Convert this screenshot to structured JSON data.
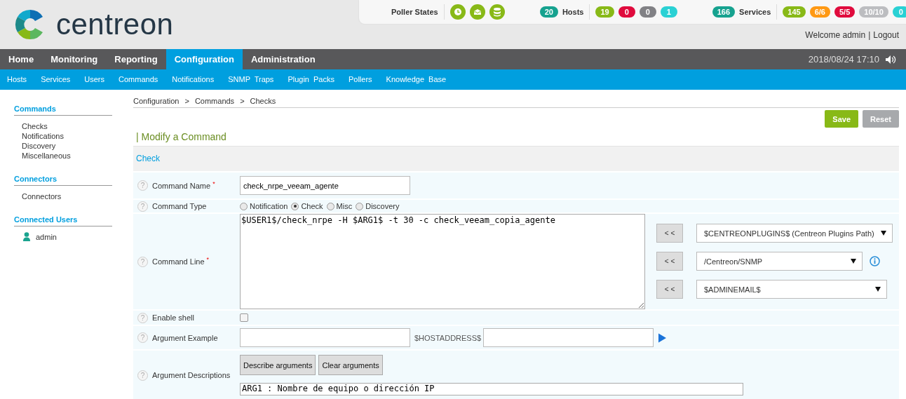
{
  "header": {
    "logo": "centreon",
    "poller_states": {
      "label": "Poller States"
    },
    "hosts": {
      "total": "20",
      "label": "Hosts",
      "badges": [
        {
          "text": "19",
          "color": "#88b917"
        },
        {
          "text": "0",
          "color": "#e00b3d"
        },
        {
          "text": "0",
          "color": "#818185"
        },
        {
          "text": "1",
          "color": "#2ad1d4"
        }
      ]
    },
    "services": {
      "total": "166",
      "label": "Services",
      "badges": [
        {
          "text": "145",
          "color": "#88b917"
        },
        {
          "text": "6/6",
          "color": "#ff9913"
        },
        {
          "text": "5/5",
          "color": "#e00b3d"
        },
        {
          "text": "10/10",
          "color": "#bcbdc0"
        },
        {
          "text": "0",
          "color": "#2ad1d4"
        }
      ]
    },
    "welcome": "Welcome admin",
    "separator": "|",
    "logout": "Logout"
  },
  "main_nav": {
    "tabs": [
      {
        "label": "Home",
        "selected": false
      },
      {
        "label": "Monitoring",
        "selected": false
      },
      {
        "label": "Reporting",
        "selected": false
      },
      {
        "label": "Configuration",
        "selected": true
      },
      {
        "label": "Administration",
        "selected": false
      }
    ],
    "datetime": "2018/08/24 17:10"
  },
  "sub_nav": {
    "items": [
      "Hosts",
      "Services",
      "Users",
      "Commands",
      "Notifications",
      "SNMP Traps",
      "Plugin Packs",
      "Pollers",
      "Knowledge Base"
    ]
  },
  "sidebar": {
    "sections": [
      {
        "title": "Commands",
        "items": [
          "Checks",
          "Notifications",
          "Discovery",
          "Miscellaneous"
        ]
      },
      {
        "title": "Connectors",
        "items": [
          "Connectors"
        ]
      },
      {
        "title": "Connected Users",
        "users": [
          "admin"
        ]
      }
    ]
  },
  "breadcrumb": {
    "items": [
      "Configuration",
      "Commands",
      "Checks"
    ],
    "separator": ">"
  },
  "buttons": [
    {
      "label": "Save",
      "kind": "primary"
    },
    {
      "label": "Reset",
      "kind": "secondary"
    }
  ],
  "form": {
    "title": "| Modify a Command",
    "section": "Check",
    "rows": [
      {
        "kind": "text",
        "help": "?",
        "label": "Command Name",
        "required_mark": "*",
        "value": "check_nrpe_veeam_agente"
      },
      {
        "kind": "radio",
        "help": "?",
        "label": "Command Type",
        "options": [
          {
            "label": "Notification",
            "selected": false
          },
          {
            "label": "Check",
            "selected": true
          },
          {
            "label": "Misc",
            "selected": false
          },
          {
            "label": "Discovery",
            "selected": false
          }
        ]
      },
      {
        "kind": "command_line",
        "help": "?",
        "label": "Command Line",
        "required_mark": "*",
        "value": "$USER1$/check_nrpe -H $ARG1$ -t 30 -c check_veeam_copia_agente",
        "macros": [
          {
            "button": "< <",
            "value": "$CENTREONPLUGINS$ (Centreon Plugins Path)",
            "info": false
          },
          {
            "button": "< <",
            "value": "/Centreon/SNMP",
            "info": true
          },
          {
            "button": "< <",
            "value": "$ADMINEMAIL$",
            "info": false
          }
        ]
      },
      {
        "kind": "checkbox",
        "help": "?",
        "label": "Enable shell",
        "checked": false
      },
      {
        "kind": "example",
        "help": "?",
        "label": "Argument Example",
        "middle_label": "$HOSTADDRESS$"
      },
      {
        "kind": "descriptions",
        "help": "?",
        "label": "Argument Descriptions",
        "buttons": [
          "Describe arguments",
          "Clear arguments"
        ],
        "value": "ARG1 : Nombre de equipo o dirección IP"
      }
    ]
  }
}
